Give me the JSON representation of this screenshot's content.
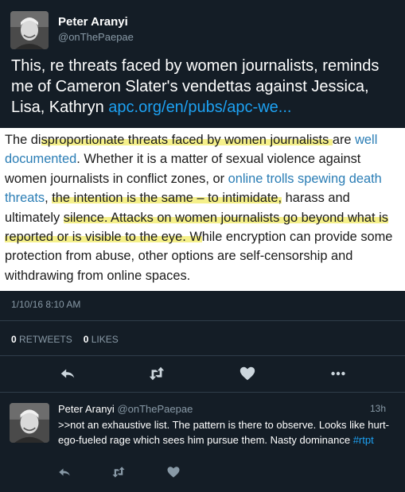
{
  "main_tweet": {
    "author_name": "Peter Aranyi",
    "author_handle": "@onThePaepae",
    "text": "This, re threats faced by women journalists, reminds me of Cameron Slater's vendettas against Jessica, Lisa, Kathryn ",
    "link": "apc.org/en/pubs/apc-we...",
    "timestamp": "1/10/16 8:10 AM",
    "retweets_count": "0",
    "retweets_label": "RETWEETS",
    "likes_count": "0",
    "likes_label": "LIKES"
  },
  "embedded_image": {
    "p1": "The di",
    "p2": "sproportionate threats faced by women journalists ",
    "p3": "are",
    "p4": "well documented",
    "p5": ". Whether it is a matter of sexual violence against women journalists in conflict zones, or ",
    "p6": "online trolls spewing death threats",
    "p7": ", ",
    "p8": "the intention is the same – to intimidate,",
    "p9": " harass and ultimately ",
    "p10": "silence. Attacks on women journalists go beyond what is reported or is visible to the eye. W",
    "p11": "hile encryption can provide some protection from abuse, other options are self-censorship and withdrawing from online spaces."
  },
  "reply_tweet": {
    "author_name": "Peter Aranyi",
    "author_handle": "@onThePaepae",
    "time": "13h",
    "text": ">>not an exhaustive list. The pattern is there to observe. Looks like hurt-ego-fueled rage which sees him pursue them. Nasty dominance ",
    "hashtag": "#rtpt"
  },
  "icons": {
    "reply": "reply-icon",
    "retweet": "retweet-icon",
    "like": "heart-icon",
    "more": "more-icon"
  },
  "colors": {
    "background": "#141d26",
    "link": "#1da1f2",
    "muted": "#8899a6",
    "highlight": "#f5f08a"
  }
}
